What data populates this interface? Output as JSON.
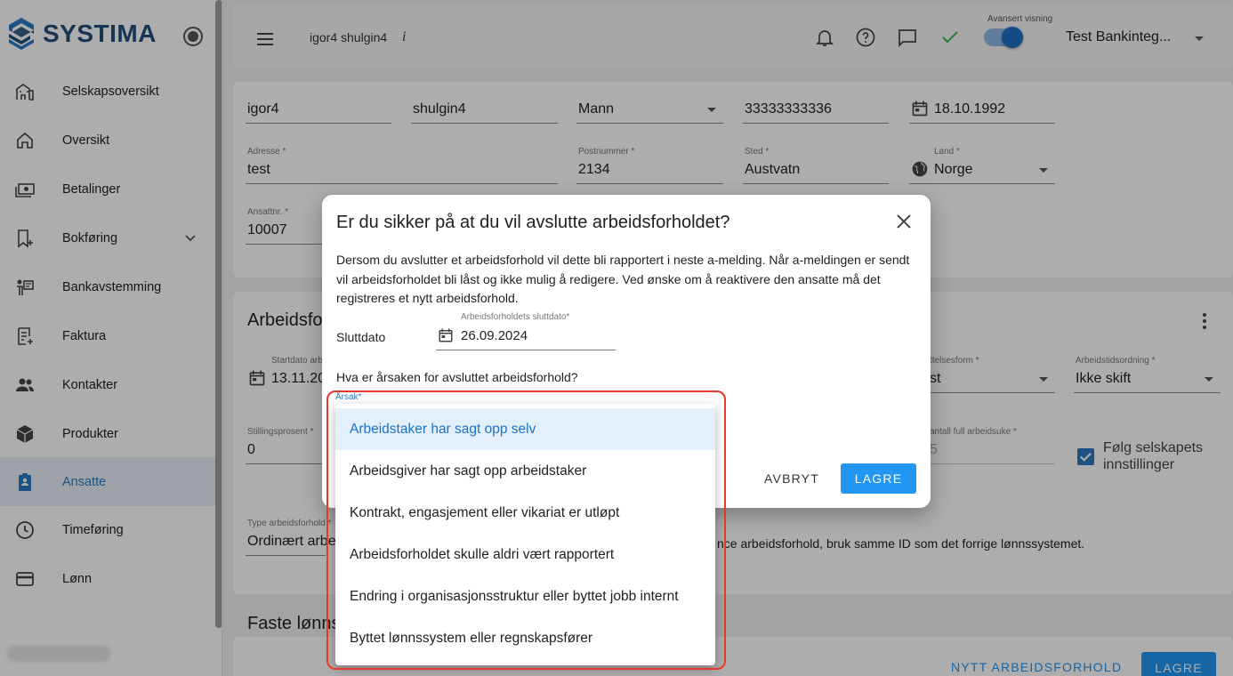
{
  "sidebar": {
    "logo_text": "SYSTIMA",
    "items": [
      {
        "label": "Selskapsoversikt",
        "icon": "building-icon"
      },
      {
        "label": "Oversikt",
        "icon": "home-icon"
      },
      {
        "label": "Betalinger",
        "icon": "payments-icon"
      },
      {
        "label": "Bokføring",
        "icon": "bookmark-add-icon"
      },
      {
        "label": "Bankavstemming",
        "icon": "bank-icon"
      },
      {
        "label": "Faktura",
        "icon": "receipt-icon"
      },
      {
        "label": "Kontakter",
        "icon": "people-icon"
      },
      {
        "label": "Produkter",
        "icon": "box-icon"
      },
      {
        "label": "Ansatte",
        "icon": "badge-icon"
      },
      {
        "label": "Timeføring",
        "icon": "clock-icon"
      },
      {
        "label": "Lønn",
        "icon": "card-icon"
      }
    ],
    "active_item": "Ansatte"
  },
  "topbar": {
    "user": "igor4 shulgin4",
    "info": "i",
    "advanced_label": "Avansert visning",
    "company": "Test Bankinteg..."
  },
  "form": {
    "first_name": "igor4",
    "last_name": "shulgin4",
    "gender": "Mann",
    "personal_number": "33333333336",
    "birth_date": "18.10.1992",
    "address_label": "Adresse *",
    "address": "test",
    "postal_label": "Postnummer *",
    "postal": "2134",
    "place_label": "Sted *",
    "place": "Austvatn",
    "country_label": "Land *",
    "country": "Norge",
    "employee_no_label": "Ansattnr. *",
    "employee_no": "10007",
    "section_title": "Arbeidsfor",
    "start_label": "Startdato arb",
    "start_value": "13.11.20",
    "pay_form_label": "ttelsesform *",
    "pay_form_value": "st",
    "work_time_label": "Arbeidstidsordning *",
    "work_time_value": "Ikke skift",
    "position_pct_label": "Stillingsprosent *",
    "position_pct": "0",
    "hours_label": "antall full arbeidsuke *",
    "hours_value": "5",
    "follow_label_1": "Følg selskapets",
    "follow_label_2": "innstillinger",
    "type_label": "Type arbeidsforhold *",
    "type_value": "Ordinært arbei",
    "hint": "nce arbeidsforhold, bruk samme ID som det forrige lønnssystemet.",
    "fixed_title": "Faste lønns",
    "new_employment_btn": "NYTT ARBEIDSFORHOLD",
    "save_btn": "LAGRE"
  },
  "dialog": {
    "title": "Er du sikker på at du vil avslutte arbeidsforholdet?",
    "text": "Dersom du avslutter et arbeidsforhold vil dette bli rapportert i neste a-melding. Når a-meldingen er sendt vil arbeidsforholdet bli låst og ikke mulig å redigere. Ved ønske om å reaktivere den ansatte må det registreres et nytt arbeidsforhold.",
    "end_date_label": "Sluttdato",
    "end_date_field_label": "Arbeidsforholdets sluttdato*",
    "end_date": "26.09.2024",
    "question": "Hva er årsaken for avsluttet arbeidsforhold?",
    "reason_label": "Årsak*",
    "cancel": "AVBRYT",
    "save": "LAGRE"
  },
  "reasons": [
    "Arbeidstaker har sagt opp selv",
    "Arbeidsgiver har sagt opp arbeidstaker",
    "Kontrakt, engasjement eller vikariat er utløpt",
    "Arbeidsforholdet skulle aldri vært rapportert",
    "Endring i organisasjonsstruktur eller byttet jobb internt",
    "Byttet lønnssystem eller regnskapsfører"
  ],
  "colors": {
    "accent": "#2196f3",
    "brand": "#1f4e79",
    "highlight": "#e53a2b"
  }
}
